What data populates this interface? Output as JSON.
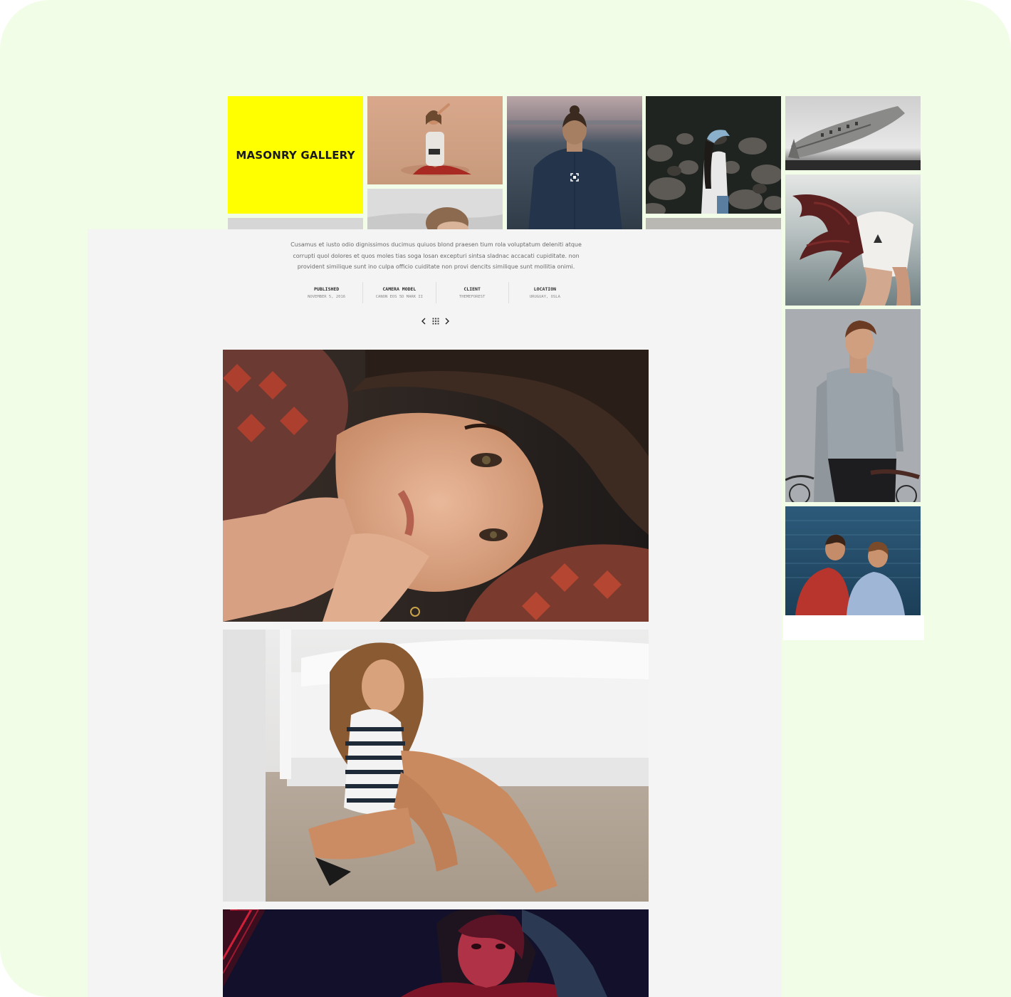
{
  "gallery": {
    "title": "MASONRY GALLERY",
    "expand_icon": "expand-icon"
  },
  "project": {
    "description": "Cusamus et iusto odio dignissimos ducimus quiuos blond praesen tium rola voluptatum deleniti atque corrupti quol dolores et quos moles tias soga losan excepturi sintsa sladnac accacati cupiditate. non provident similique sunt ino culpa officio cuiditate non provi dencits similique sunt mollitia onimi.",
    "meta": [
      {
        "label": "PUBLISHED",
        "value": "NOVEMBER 5, 2016"
      },
      {
        "label": "CAMERA MODEL",
        "value": "CANON EOS 5D MARK II"
      },
      {
        "label": "CLIENT",
        "value": "THEMEFOREST"
      },
      {
        "label": "LOCATION",
        "value": "URUGUAY, OSLA"
      }
    ],
    "nav": {
      "prev_icon": "chevron-left-icon",
      "grid_icon": "grid-icon",
      "next_icon": "chevron-right-icon"
    }
  },
  "colors": {
    "background": "#f2fde7",
    "accent": "#ffff00",
    "panel": "#f4f4f4"
  }
}
